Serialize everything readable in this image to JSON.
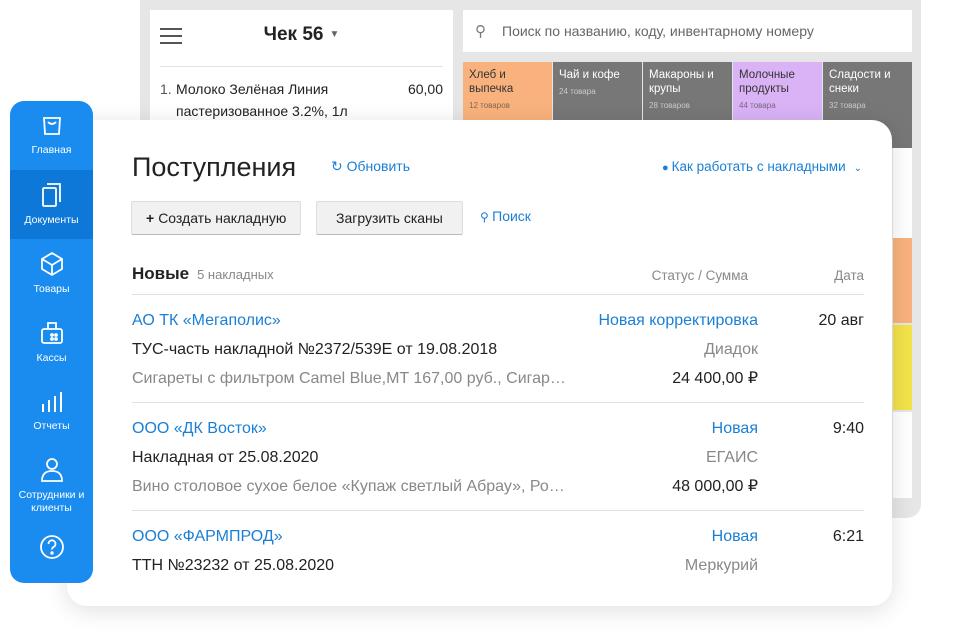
{
  "pos": {
    "check_title": "Чек 56",
    "item": {
      "num": "1.",
      "name": "Молоко Зелёная Линия пастеризованное 3.2%, 1л",
      "price": "60,00"
    },
    "search_placeholder": "Поиск по названию, коду, инвентарному номеру",
    "categories": [
      {
        "name": "Хлеб и выпечка",
        "count": "12 товаров",
        "color": "#f9b27d"
      },
      {
        "name": "Чай и кофе",
        "count": "24 товара",
        "color": "#7a7a7a"
      },
      {
        "name": "Макароны и крупы",
        "count": "28 товаров",
        "color": "#7a7a7a"
      },
      {
        "name": "Молочные продукты",
        "count": "44 товара",
        "color": "#d9b3f5"
      },
      {
        "name": "Сладости и снеки",
        "count": "32 товара",
        "color": "#7a7a7a"
      }
    ]
  },
  "sidebar": {
    "items": [
      {
        "label": "Главная"
      },
      {
        "label": "Документы"
      },
      {
        "label": "Товары"
      },
      {
        "label": "Кассы"
      },
      {
        "label": "Отчеты"
      },
      {
        "label": "Сотрудники и клиенты"
      }
    ]
  },
  "main": {
    "title": "Поступления",
    "refresh": "Обновить",
    "help": "Как работать с накладными",
    "create": "Создать накладную",
    "upload": "Загрузить сканы",
    "search": "Поиск",
    "section": "Новые",
    "section_count": "5 накладных",
    "col_status": "Статус / Сумма",
    "col_date": "Дата",
    "rows": [
      {
        "org": "АО ТК «Мегаполис»",
        "status": "Новая корректировка",
        "date": "20 авг",
        "doc": "ТУС-часть накладной №2372/539Е от 19.08.2018",
        "source": "Диадок",
        "desc": "Сигареты с фильтром Camel Blue,MT 167,00 руб., Сигареты...",
        "sum": "24 400,00 ₽"
      },
      {
        "org": "ООО «ДК Восток»",
        "status": "Новая",
        "date": "9:40",
        "doc": "Накладная от 25.08.2020",
        "source": "ЕГАИС",
        "desc": "Вино столовое сухое белое «Купаж светлый Абрау», Российское...",
        "sum": "48 000,00 ₽"
      },
      {
        "org": "ООО «ФАРМПРОД»",
        "status": "Новая",
        "date": "6:21",
        "doc": "ТТН №23232 от 25.08.2020",
        "source": "Меркурий"
      }
    ]
  }
}
